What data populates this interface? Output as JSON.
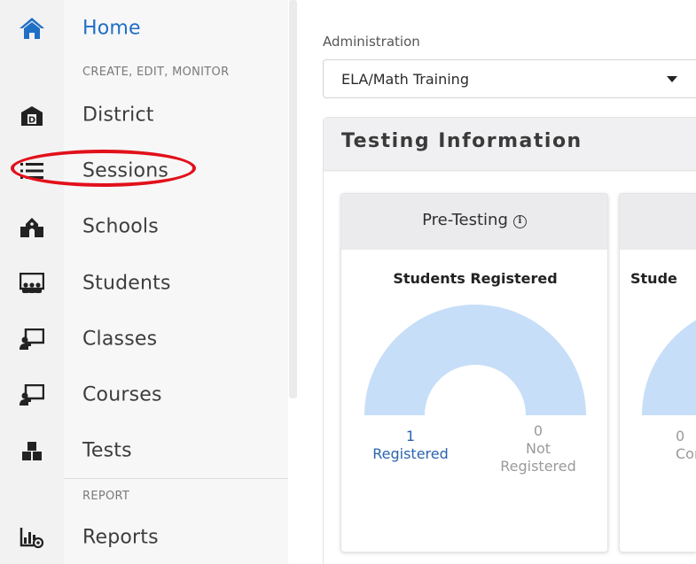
{
  "sidebar": {
    "home": {
      "label": "Home",
      "icon": "home-icon"
    },
    "section_create": "CREATE, EDIT, MONITOR",
    "items": [
      {
        "label": "District",
        "icon": "district-icon"
      },
      {
        "label": "Sessions",
        "icon": "sessions-icon"
      },
      {
        "label": "Schools",
        "icon": "schools-icon"
      },
      {
        "label": "Students",
        "icon": "students-icon"
      },
      {
        "label": "Classes",
        "icon": "classes-icon"
      },
      {
        "label": "Courses",
        "icon": "courses-icon"
      },
      {
        "label": "Tests",
        "icon": "tests-icon"
      }
    ],
    "section_report": "REPORT",
    "reports": {
      "label": "Reports",
      "icon": "reports-icon"
    }
  },
  "main": {
    "administration_label": "Administration",
    "administration_value": "ELA/Math Training",
    "panel_title": "Testing Information",
    "cards": [
      {
        "title": "Pre-Testing",
        "chart_title": "Students Registered",
        "legend": {
          "registered_count": "1",
          "registered_label": "Registered",
          "not_registered_count": "0",
          "not_registered_line1": "Not",
          "not_registered_line2": "Registered"
        }
      },
      {
        "chart_title": "Stude",
        "legend": {
          "count": "0",
          "label": "Compl"
        }
      }
    ]
  },
  "colors": {
    "accent": "#1f6fc5",
    "gauge_fill": "#c7def8",
    "annotation": "#e2101a"
  },
  "chart_data": [
    {
      "type": "pie",
      "title": "Students Registered",
      "categories": [
        "Registered",
        "Not Registered"
      ],
      "values": [
        1,
        0
      ]
    }
  ]
}
